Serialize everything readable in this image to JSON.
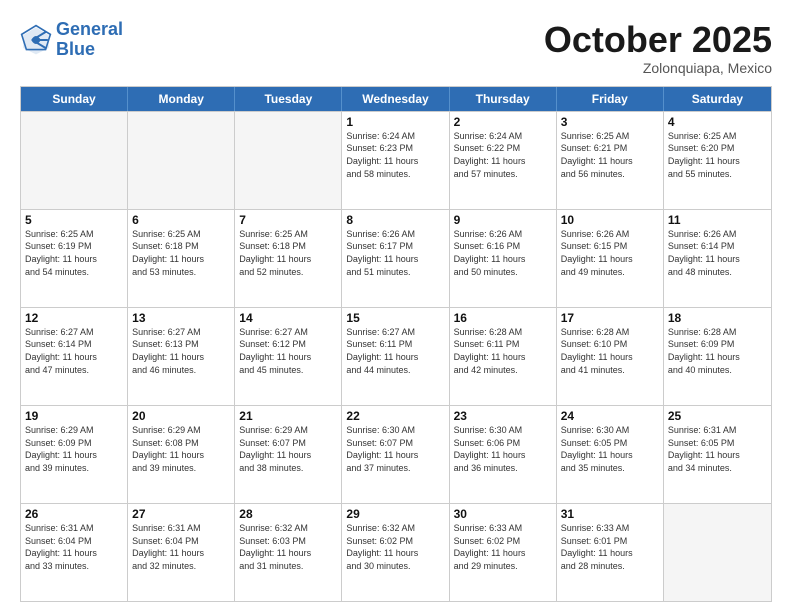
{
  "header": {
    "logo_line1": "General",
    "logo_line2": "Blue",
    "month": "October 2025",
    "location": "Zolonquiapa, Mexico"
  },
  "days_of_week": [
    "Sunday",
    "Monday",
    "Tuesday",
    "Wednesday",
    "Thursday",
    "Friday",
    "Saturday"
  ],
  "rows": [
    [
      {
        "day": "",
        "text": "",
        "empty": true
      },
      {
        "day": "",
        "text": "",
        "empty": true
      },
      {
        "day": "",
        "text": "",
        "empty": true
      },
      {
        "day": "1",
        "text": "Sunrise: 6:24 AM\nSunset: 6:23 PM\nDaylight: 11 hours\nand 58 minutes."
      },
      {
        "day": "2",
        "text": "Sunrise: 6:24 AM\nSunset: 6:22 PM\nDaylight: 11 hours\nand 57 minutes."
      },
      {
        "day": "3",
        "text": "Sunrise: 6:25 AM\nSunset: 6:21 PM\nDaylight: 11 hours\nand 56 minutes."
      },
      {
        "day": "4",
        "text": "Sunrise: 6:25 AM\nSunset: 6:20 PM\nDaylight: 11 hours\nand 55 minutes."
      }
    ],
    [
      {
        "day": "5",
        "text": "Sunrise: 6:25 AM\nSunset: 6:19 PM\nDaylight: 11 hours\nand 54 minutes."
      },
      {
        "day": "6",
        "text": "Sunrise: 6:25 AM\nSunset: 6:18 PM\nDaylight: 11 hours\nand 53 minutes."
      },
      {
        "day": "7",
        "text": "Sunrise: 6:25 AM\nSunset: 6:18 PM\nDaylight: 11 hours\nand 52 minutes."
      },
      {
        "day": "8",
        "text": "Sunrise: 6:26 AM\nSunset: 6:17 PM\nDaylight: 11 hours\nand 51 minutes."
      },
      {
        "day": "9",
        "text": "Sunrise: 6:26 AM\nSunset: 6:16 PM\nDaylight: 11 hours\nand 50 minutes."
      },
      {
        "day": "10",
        "text": "Sunrise: 6:26 AM\nSunset: 6:15 PM\nDaylight: 11 hours\nand 49 minutes."
      },
      {
        "day": "11",
        "text": "Sunrise: 6:26 AM\nSunset: 6:14 PM\nDaylight: 11 hours\nand 48 minutes."
      }
    ],
    [
      {
        "day": "12",
        "text": "Sunrise: 6:27 AM\nSunset: 6:14 PM\nDaylight: 11 hours\nand 47 minutes."
      },
      {
        "day": "13",
        "text": "Sunrise: 6:27 AM\nSunset: 6:13 PM\nDaylight: 11 hours\nand 46 minutes."
      },
      {
        "day": "14",
        "text": "Sunrise: 6:27 AM\nSunset: 6:12 PM\nDaylight: 11 hours\nand 45 minutes."
      },
      {
        "day": "15",
        "text": "Sunrise: 6:27 AM\nSunset: 6:11 PM\nDaylight: 11 hours\nand 44 minutes."
      },
      {
        "day": "16",
        "text": "Sunrise: 6:28 AM\nSunset: 6:11 PM\nDaylight: 11 hours\nand 42 minutes."
      },
      {
        "day": "17",
        "text": "Sunrise: 6:28 AM\nSunset: 6:10 PM\nDaylight: 11 hours\nand 41 minutes."
      },
      {
        "day": "18",
        "text": "Sunrise: 6:28 AM\nSunset: 6:09 PM\nDaylight: 11 hours\nand 40 minutes."
      }
    ],
    [
      {
        "day": "19",
        "text": "Sunrise: 6:29 AM\nSunset: 6:09 PM\nDaylight: 11 hours\nand 39 minutes."
      },
      {
        "day": "20",
        "text": "Sunrise: 6:29 AM\nSunset: 6:08 PM\nDaylight: 11 hours\nand 39 minutes."
      },
      {
        "day": "21",
        "text": "Sunrise: 6:29 AM\nSunset: 6:07 PM\nDaylight: 11 hours\nand 38 minutes."
      },
      {
        "day": "22",
        "text": "Sunrise: 6:30 AM\nSunset: 6:07 PM\nDaylight: 11 hours\nand 37 minutes."
      },
      {
        "day": "23",
        "text": "Sunrise: 6:30 AM\nSunset: 6:06 PM\nDaylight: 11 hours\nand 36 minutes."
      },
      {
        "day": "24",
        "text": "Sunrise: 6:30 AM\nSunset: 6:05 PM\nDaylight: 11 hours\nand 35 minutes."
      },
      {
        "day": "25",
        "text": "Sunrise: 6:31 AM\nSunset: 6:05 PM\nDaylight: 11 hours\nand 34 minutes."
      }
    ],
    [
      {
        "day": "26",
        "text": "Sunrise: 6:31 AM\nSunset: 6:04 PM\nDaylight: 11 hours\nand 33 minutes."
      },
      {
        "day": "27",
        "text": "Sunrise: 6:31 AM\nSunset: 6:04 PM\nDaylight: 11 hours\nand 32 minutes."
      },
      {
        "day": "28",
        "text": "Sunrise: 6:32 AM\nSunset: 6:03 PM\nDaylight: 11 hours\nand 31 minutes."
      },
      {
        "day": "29",
        "text": "Sunrise: 6:32 AM\nSunset: 6:02 PM\nDaylight: 11 hours\nand 30 minutes."
      },
      {
        "day": "30",
        "text": "Sunrise: 6:33 AM\nSunset: 6:02 PM\nDaylight: 11 hours\nand 29 minutes."
      },
      {
        "day": "31",
        "text": "Sunrise: 6:33 AM\nSunset: 6:01 PM\nDaylight: 11 hours\nand 28 minutes."
      },
      {
        "day": "",
        "text": "",
        "empty": true
      }
    ]
  ]
}
